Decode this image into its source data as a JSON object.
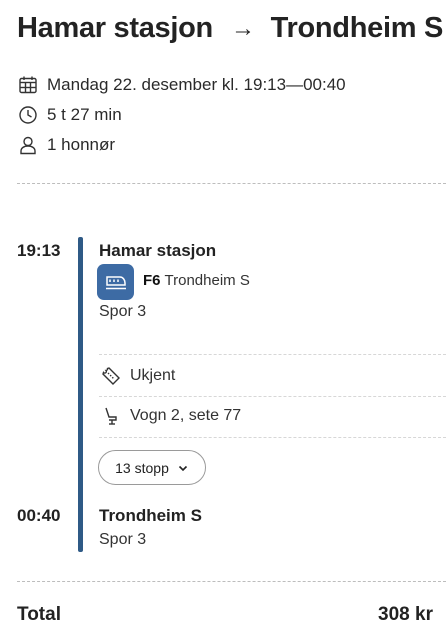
{
  "header": {
    "from": "Hamar stasjon",
    "arrow": "→",
    "to": "Trondheim S"
  },
  "trip_meta": {
    "date_time": "Mandag 22. desember kl. 19:13—00:40",
    "duration": "5 t 27 min",
    "passengers": "1 honnør",
    "icons": [
      "calendar-icon",
      "clock-icon",
      "person-icon"
    ]
  },
  "leg": {
    "departure_time": "19:13",
    "departure_station": "Hamar stasjon",
    "line": "F6",
    "destination": "Trondheim S",
    "departure_track": "Spor 3",
    "ticket_status": "Ukjent",
    "seat": "Vogn 2, sete 77",
    "stops_button": "13 stopp",
    "arrival_time": "00:40",
    "arrival_station": "Trondheim S",
    "arrival_track": "Spor 3"
  },
  "summary": {
    "total_label": "Total",
    "total_value": "308 kr"
  },
  "colors": {
    "line_bar": "#2f5a86",
    "train_badge": "#3d6ba4"
  }
}
